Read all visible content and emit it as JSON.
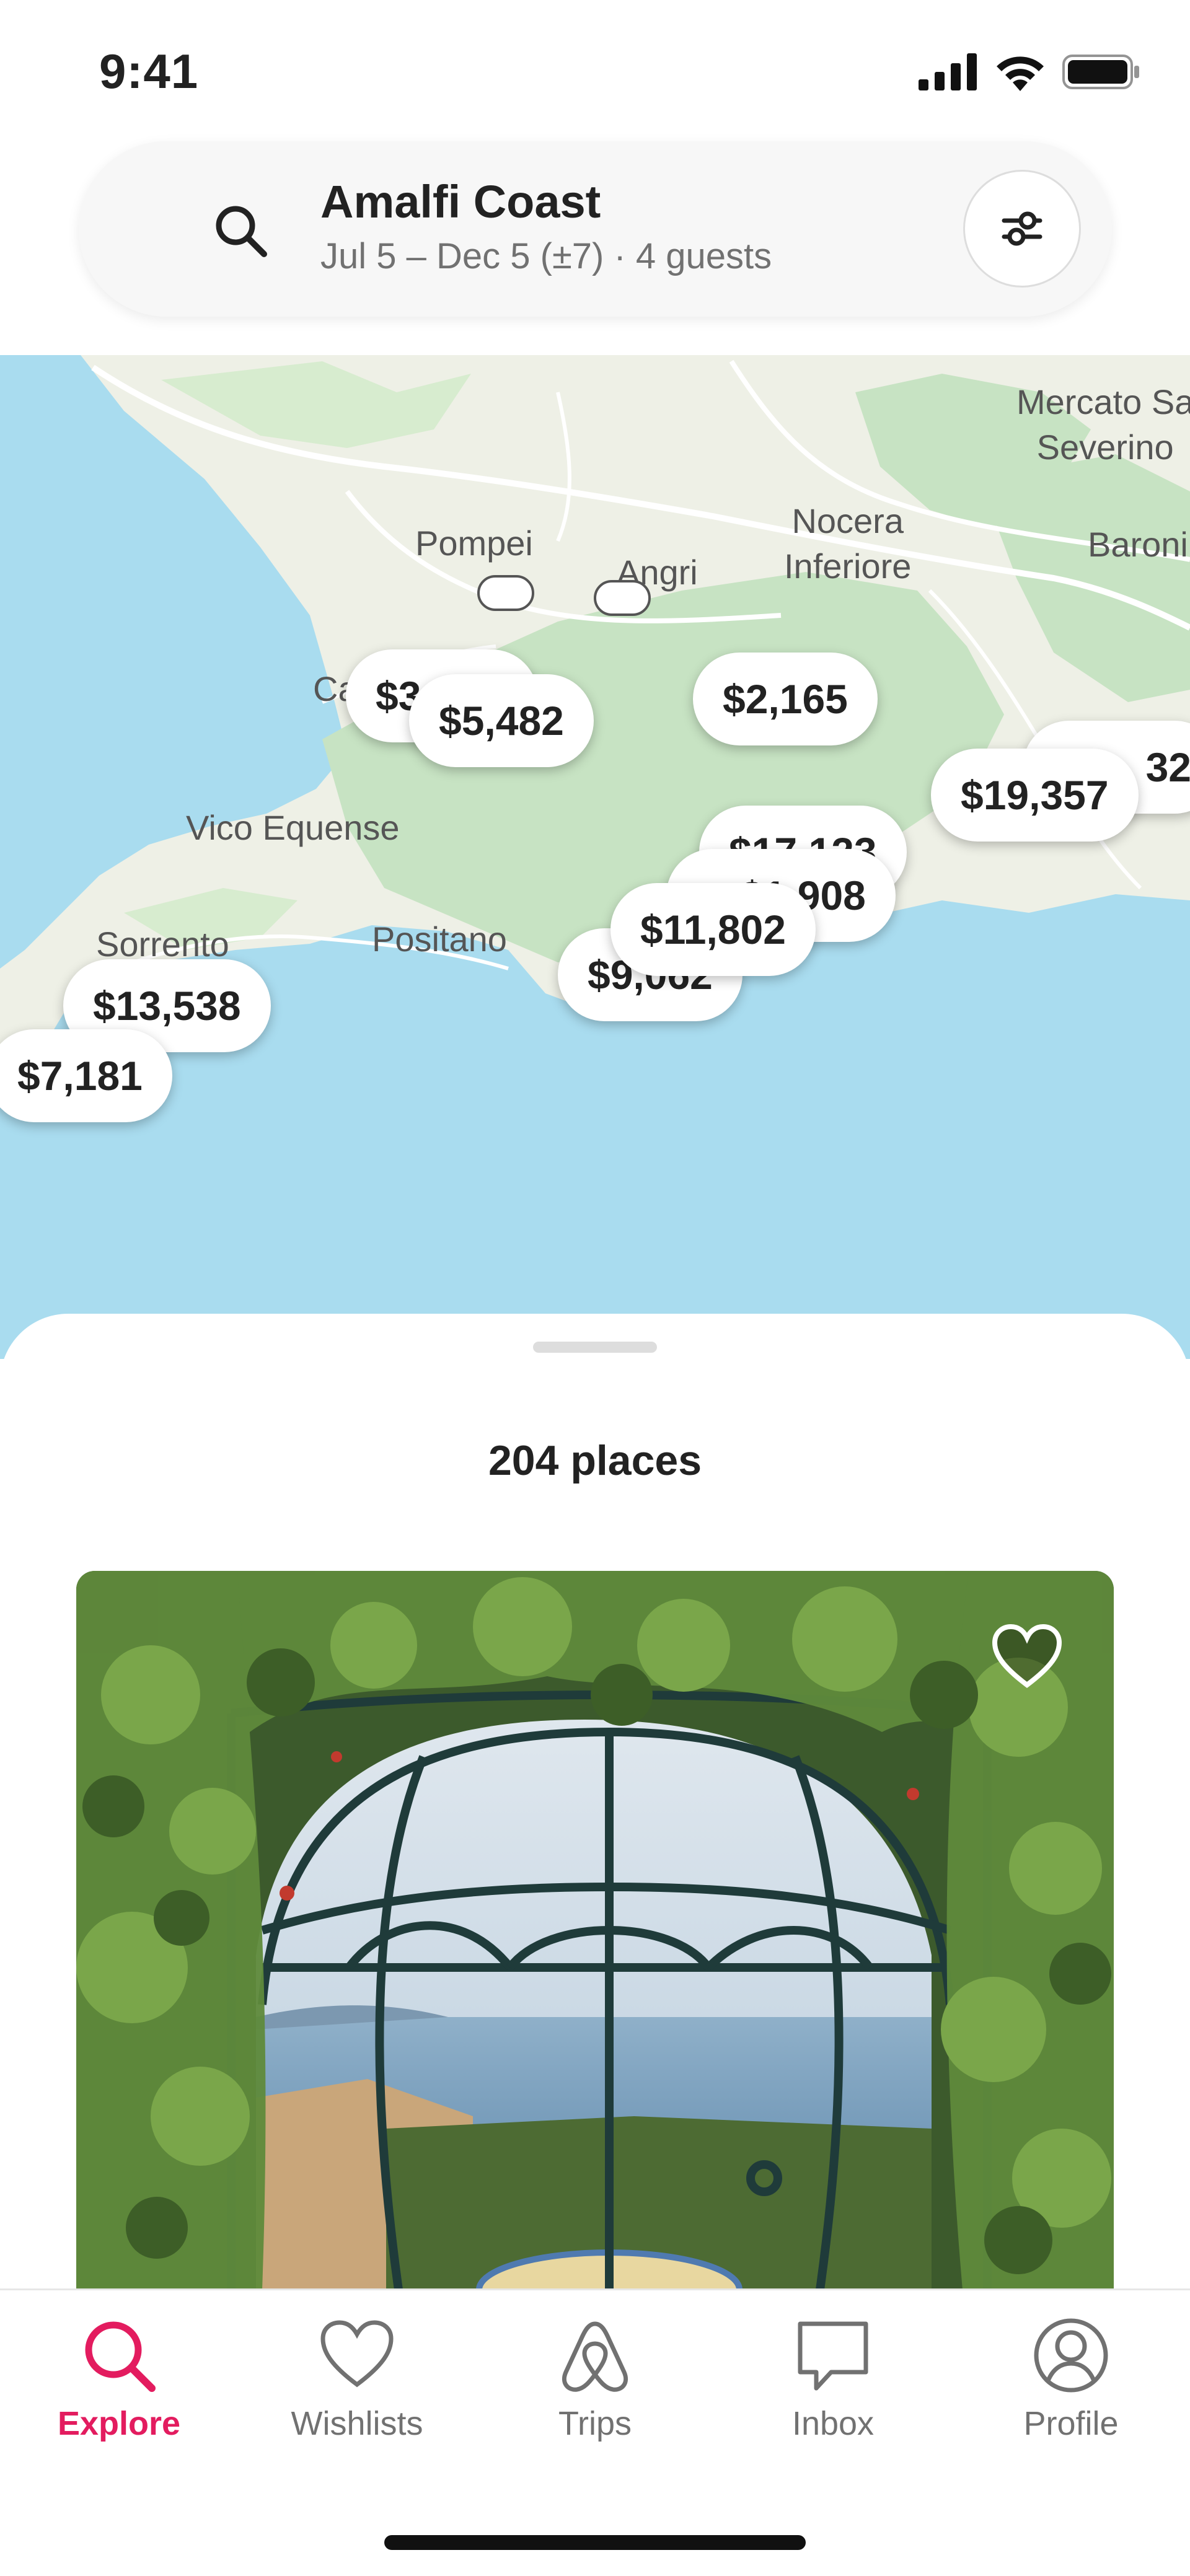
{
  "status_bar": {
    "time": "9:41",
    "icons": [
      "signal-icon",
      "wifi-icon",
      "battery-icon"
    ]
  },
  "search": {
    "destination": "Amalfi Coast",
    "details": "Jul 5 – Dec 5 (±7) · 4 guests",
    "icon": "search-icon",
    "filter_icon": "sliders-icon"
  },
  "map": {
    "labels": {
      "mercato": "Mercato Sa\nSeverino",
      "pompei": "Pompei",
      "angri": "Angri",
      "nocera": "Nocera\nInferiore",
      "baroni": "Baroni",
      "vico": "Vico Equense",
      "sorrento": "Sorrento",
      "positano": "Positano",
      "ca": "Ca"
    },
    "prices": {
      "p1": "$3",
      "p2": "$5,482",
      "p3": "$2,165",
      "p4": "32",
      "p5": "$19,357",
      "p6": "$17,123",
      "p7": "$1,908",
      "p8": "$11,802",
      "p9": "$9,062",
      "p10": "$13,538",
      "p11": "$7,181"
    }
  },
  "results": {
    "count_label": "204 places"
  },
  "tabs": [
    {
      "label": "Explore",
      "icon": "search-icon",
      "active": true
    },
    {
      "label": "Wishlists",
      "icon": "heart-icon",
      "active": false
    },
    {
      "label": "Trips",
      "icon": "airbnb-logo-icon",
      "active": false
    },
    {
      "label": "Inbox",
      "icon": "message-icon",
      "active": false
    },
    {
      "label": "Profile",
      "icon": "profile-icon",
      "active": false
    }
  ],
  "colors": {
    "accent": "#e31c5f",
    "sea": "#a9dcef",
    "land": "#eef0e6",
    "hills": "#c7e3c3"
  }
}
